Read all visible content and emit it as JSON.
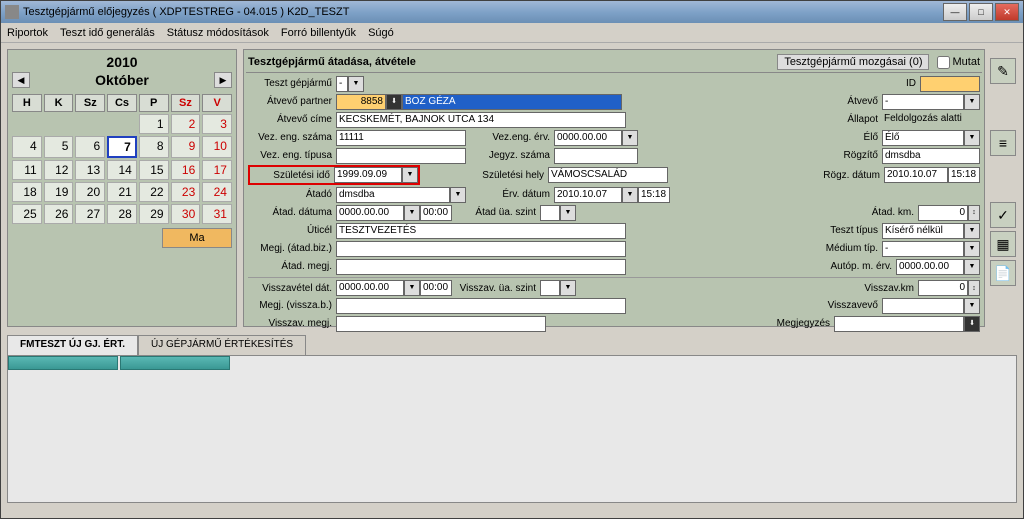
{
  "window": {
    "title": "Tesztgépjármű előjegyzés ( XDPTESTREG - 04.015 )     K2D_TESZT",
    "min_label": "—",
    "max_label": "□",
    "close_label": "✕"
  },
  "menu": [
    "Riportok",
    "Teszt idő generálás",
    "Státusz módosítások",
    "Forró billentyűk",
    "Súgó"
  ],
  "calendar": {
    "year": "2010",
    "month": "Október",
    "days_header": [
      "H",
      "K",
      "Sz",
      "Cs",
      "P",
      "Sz",
      "V"
    ],
    "today_btn": "Ma",
    "selected_day": "7"
  },
  "form": {
    "header_title": "Tesztgépjármű átadása, átvétele",
    "movements": "Tesztgépjármű mozgásai (0)",
    "mutat_label": "Mutat",
    "labels": {
      "teszt_gepjarmu": "Teszt gépjármű",
      "id": "ID",
      "atvevo_partner": "Átvevő partner",
      "atvevo": "Átvevő",
      "atvevo_cime": "Átvevő címe",
      "allapot": "Állapot",
      "vez_eng_szama": "Vez. eng. száma",
      "vez_eng_erv": "Vez.eng. érv.",
      "elo": "Élő",
      "vez_eng_tipusa": "Vez. eng. típusa",
      "jegyz_szama": "Jegyz. száma",
      "rogzito": "Rögzítő",
      "szuletesi_ido": "Születési idő",
      "szuletesi_hely": "Születési hely",
      "rogz_datum": "Rögz. dátum",
      "atado": "Átadó",
      "erv_datum": "Érv. dátum",
      "atad_datuma": "Átad. dátuma",
      "atad_ua_szint": "Átad üa. szint",
      "atad_km": "Átad. km.",
      "uticei": "Úticél",
      "teszt_tipus": "Teszt típus",
      "megj_atad_biz": "Megj. (átad.biz.)",
      "medium_tip": "Médium típ.",
      "atad_megj": "Átad. megj.",
      "autop_m_erv": "Autóp. m. érv.",
      "visszavetel_dat": "Visszavétel dát.",
      "visszav_ua_szint": "Visszav. üa. szint",
      "visszav_km": "Visszav.km",
      "megj_vissza_b": "Megj. (vissza.b.)",
      "visszavevo": "Visszavevő",
      "visszav_megj": "Visszav. megj.",
      "megjegyzes": "Megjegyzés"
    },
    "values": {
      "teszt_gepjarmu": "-",
      "id": "",
      "atvevo_partner_code": "8858",
      "atvevo_partner_name": "BOZ GÉZA",
      "atvevo": "-",
      "atvevo_cime": "KECSKEMÉT, BAJNOK UTCA 134",
      "allapot": "Feldolgozás alatti",
      "vez_eng_szama": "11111",
      "vez_eng_erv": "0000.00.00",
      "elo": "Élő",
      "vez_eng_tipusa": "",
      "jegyz_szama": "",
      "rogzito": "dmsdba",
      "szuletesi_ido": "1999.09.09",
      "szuletesi_hely": "VÁMOSCSALÁD",
      "rogz_datum_date": "2010.10.07",
      "rogz_datum_time": "15:18",
      "atado": "dmsdba",
      "erv_datum_date": "2010.10.07",
      "erv_datum_time": "15:18",
      "atad_datuma_date": "0000.00.00",
      "atad_datuma_time": "00:00",
      "atad_ua_szint": "",
      "atad_km": "0",
      "uticei": "TESZTVEZETÉS",
      "teszt_tipus": "Kísérő nélkül",
      "megj_atad_biz": "",
      "medium_tip": "-",
      "atad_megj": "",
      "autop_m_erv": "0000.00.00",
      "visszavetel_dat_date": "0000.00.00",
      "visszavetel_dat_time": "00:00",
      "visszav_ua_szint": "",
      "visszav_km": "0",
      "megj_vissza_b": "",
      "visszavevo": "",
      "visszav_megj": "",
      "megjegyzes": ""
    }
  },
  "tabs": {
    "active": "FMTESZT ÚJ GJ. ÉRT.",
    "inactive": "ÚJ GÉPJÁRMŰ ÉRTÉKESÍTÉS"
  }
}
